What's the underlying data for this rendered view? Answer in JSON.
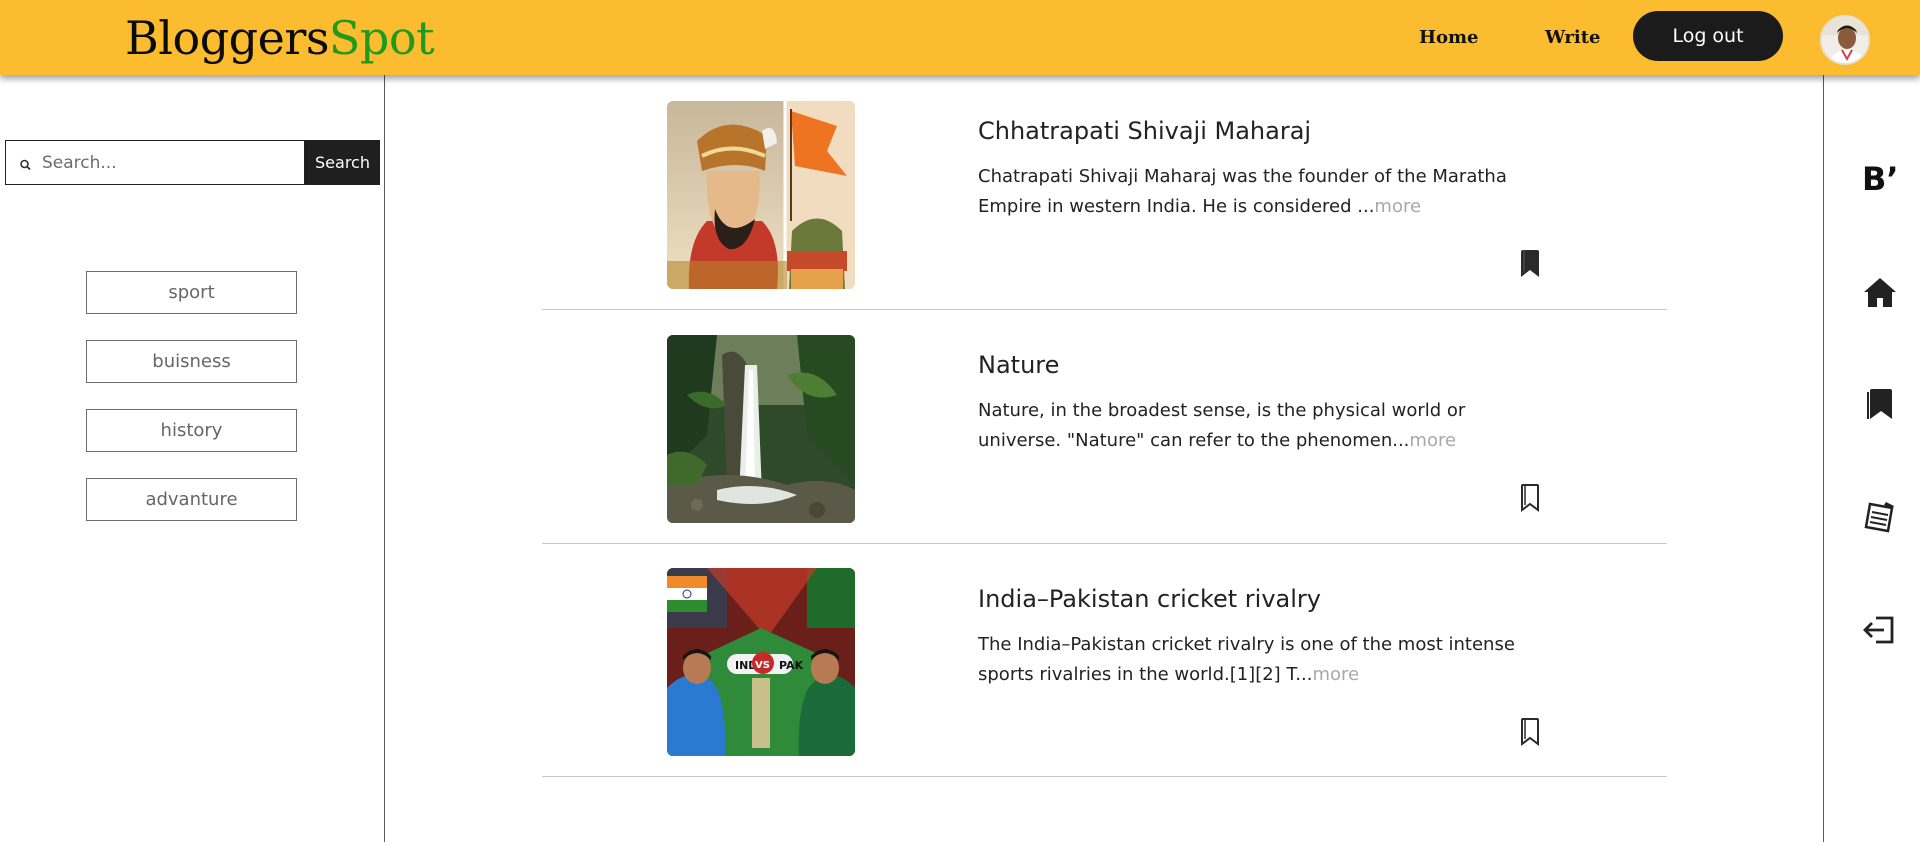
{
  "header": {
    "brand_part1": "Bloggers",
    "brand_part2": "Spot",
    "nav": {
      "home": "Home",
      "write": "Write"
    },
    "logout_label": "Log out",
    "accent": "#fbbd2f",
    "brand_green": "#1f9a1f"
  },
  "sidebar": {
    "search": {
      "placeholder": "Search...",
      "value": "",
      "button_label": "Search"
    },
    "categories": [
      "sport",
      "buisness",
      "history",
      "advanture"
    ]
  },
  "posts": [
    {
      "title": "Chhatrapati Shivaji Maharaj",
      "excerpt": "Chatrapati Shivaji Maharaj was the founder of the Maratha Empire in western India. He is considered ...",
      "more": "more",
      "bookmarked": true
    },
    {
      "title": "Nature",
      "excerpt": "Nature, in the broadest sense, is the physical world or universe. \"Nature\" can refer to the phenomen...",
      "more": "more",
      "bookmarked": false
    },
    {
      "title": "India–Pakistan cricket rivalry",
      "excerpt": "The India–Pakistan cricket rivalry is one of the most intense sports rivalries in the world.[1][2] T...",
      "more": "more",
      "bookmarked": false
    }
  ],
  "thumb_labels": {
    "ind": "IND",
    "pak": "PAK",
    "vs": "VS"
  },
  "right_rail": {
    "logo_text": "B’",
    "icons": [
      "brand-logo-icon",
      "home-icon",
      "bookmarks-icon",
      "notes-icon",
      "logout-icon"
    ]
  }
}
